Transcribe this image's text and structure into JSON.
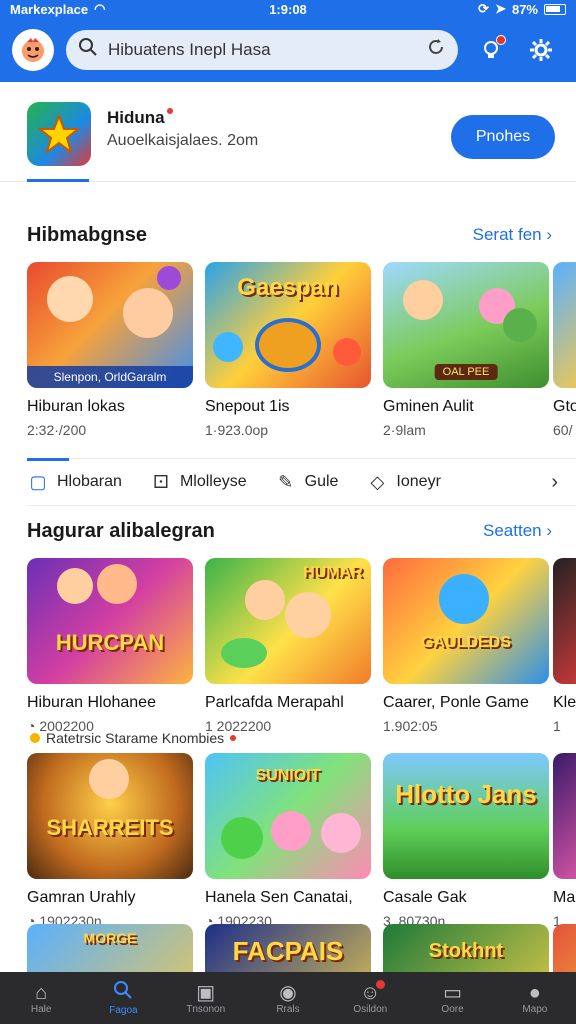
{
  "status_bar": {
    "carrier": "Markexplace",
    "time": "1:9:08",
    "battery": "87%"
  },
  "header": {
    "search_value": "Hibuatens Inepl Hasa"
  },
  "featured": {
    "title": "Hiduna",
    "subtitle": "Auoelkaisjalaes. 2om",
    "button_label": "Pnohes"
  },
  "section1": {
    "title": "Hibmabgnse",
    "see_more": "Serat fen",
    "cards": [
      {
        "name": "Hiburan lokas",
        "meta": "2:32·/200",
        "caption": "Slenpon, OrldGaralm"
      },
      {
        "name": "Snepout 1is",
        "meta": "1·923.0op",
        "banner": "Gaespan"
      },
      {
        "name": "Gminen Aulit",
        "meta": "2·9lam",
        "chip": "OAL PEE"
      },
      {
        "name": "Gto",
        "meta": "60/"
      }
    ]
  },
  "categories": [
    {
      "label": "Hlobaran",
      "icon": "square-badge-icon"
    },
    {
      "label": "Mlolleyse",
      "icon": "dice-icon"
    },
    {
      "label": "Gule",
      "icon": "pen-icon"
    },
    {
      "label": "Ioneyr",
      "icon": "tag-icon"
    }
  ],
  "section2": {
    "title": "Hagurar alibalegran",
    "see_more": "Seatten",
    "cards": [
      {
        "name": "Hiburan Hlohanee",
        "meta": "2002200",
        "banner": "HURCPAN"
      },
      {
        "name": "Parlcafda Merapahl",
        "meta": "1 2022200",
        "banner": "HUMAR"
      },
      {
        "name": "Caarer, Ponle Game",
        "meta": "1.902:05",
        "banner": "GAULDEDS"
      },
      {
        "name": "Kle",
        "meta": "1"
      }
    ]
  },
  "sponsored": {
    "label": "Ratetrsic Starame Knombies"
  },
  "section3": {
    "cards": [
      {
        "name": "Gamran Urahly",
        "meta": "1902230n",
        "banner": "SHARREITS"
      },
      {
        "name": "Hanela Sen Canatai,",
        "meta": "1902230",
        "banner": "SUNIOIT"
      },
      {
        "name": "Casale Gak",
        "meta": "3. 80730n",
        "banner": "Hlotto Jans"
      },
      {
        "name": "Mai",
        "meta": "1"
      }
    ]
  },
  "section4": {
    "cards": [
      {
        "banner": "MORGE"
      },
      {
        "banner": "FACPAIS"
      },
      {
        "banner": "Stokhnt"
      },
      {
        "banner": ""
      }
    ]
  },
  "bottom_nav": [
    {
      "label": "Hale",
      "icon": "home-icon"
    },
    {
      "label": "Fagoa",
      "icon": "search-icon"
    },
    {
      "label": "Tnsonon",
      "icon": "gamepad-icon"
    },
    {
      "label": "Rrals",
      "icon": "steam-icon"
    },
    {
      "label": "Osildon",
      "icon": "person-icon"
    },
    {
      "label": "Oore",
      "icon": "monitor-icon"
    },
    {
      "label": "Mapo",
      "icon": "profile-icon"
    }
  ]
}
